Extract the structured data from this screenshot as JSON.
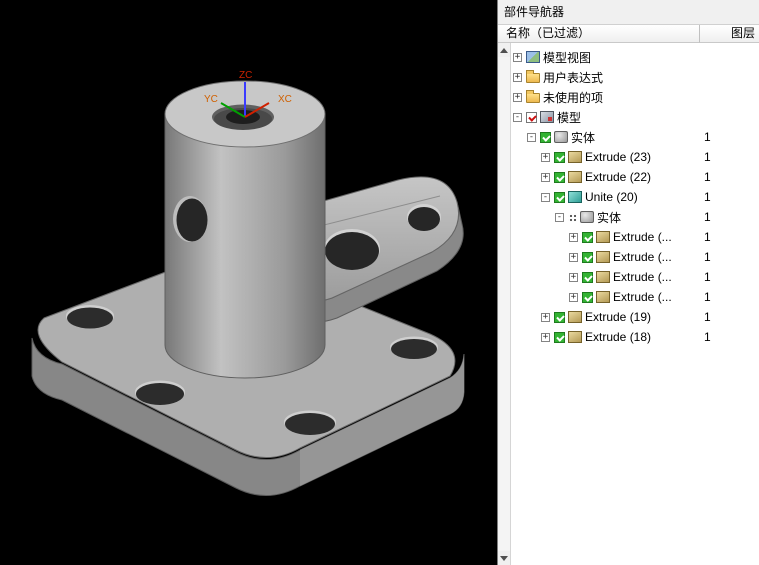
{
  "panel": {
    "title": "部件导航器",
    "columns": {
      "name": "名称（已过滤）",
      "layer": "图层"
    }
  },
  "viewport": {
    "triad": {
      "z": "ZC",
      "y": "YC",
      "x": "XC"
    }
  },
  "colors": {
    "checkbox_green": "#33b333",
    "check_red": "#cc1111",
    "axis_z_blue": "#3b3bff",
    "axis_y_green": "#00a000",
    "axis_x_red": "#d02000",
    "triad_label_red": "#cc2200",
    "triad_label_orange": "#d06000"
  },
  "tree": {
    "items": [
      {
        "label": "模型视图",
        "expand": "+",
        "icon": "model-views",
        "checkbox": "none",
        "layer": ""
      },
      {
        "label": "用户表达式",
        "expand": "+",
        "icon": "folder",
        "checkbox": "none",
        "layer": ""
      },
      {
        "label": "未使用的项",
        "expand": "+",
        "icon": "folder",
        "checkbox": "none",
        "layer": ""
      },
      {
        "label": "模型",
        "expand": "-",
        "icon": "history",
        "checkbox": "red",
        "layer": ""
      },
      {
        "label": "实体",
        "expand": "-",
        "icon": "body",
        "checkbox": "green",
        "layer": "1"
      },
      {
        "label": "Extrude (23)",
        "expand": "+",
        "icon": "extrude",
        "checkbox": "green",
        "layer": "1"
      },
      {
        "label": "Extrude (22)",
        "expand": "+",
        "icon": "extrude",
        "checkbox": "green",
        "layer": "1"
      },
      {
        "label": "Unite (20)",
        "expand": "-",
        "icon": "unite",
        "checkbox": "green",
        "layer": "1"
      },
      {
        "label": "实体",
        "expand": "-",
        "icon": "body-grid",
        "checkbox": "none",
        "layer": "1"
      },
      {
        "label": "Extrude (...",
        "expand": "+",
        "icon": "extrude",
        "checkbox": "green",
        "layer": "1"
      },
      {
        "label": "Extrude (...",
        "expand": "+",
        "icon": "extrude",
        "checkbox": "green",
        "layer": "1"
      },
      {
        "label": "Extrude (...",
        "expand": "+",
        "icon": "extrude",
        "checkbox": "green",
        "layer": "1"
      },
      {
        "label": "Extrude (...",
        "expand": "+",
        "icon": "extrude",
        "checkbox": "green",
        "layer": "1"
      },
      {
        "label": "Extrude (19)",
        "expand": "+",
        "icon": "extrude",
        "checkbox": "green",
        "layer": "1"
      },
      {
        "label": "Extrude (18)",
        "expand": "+",
        "icon": "extrude",
        "checkbox": "green",
        "layer": "1"
      }
    ]
  }
}
